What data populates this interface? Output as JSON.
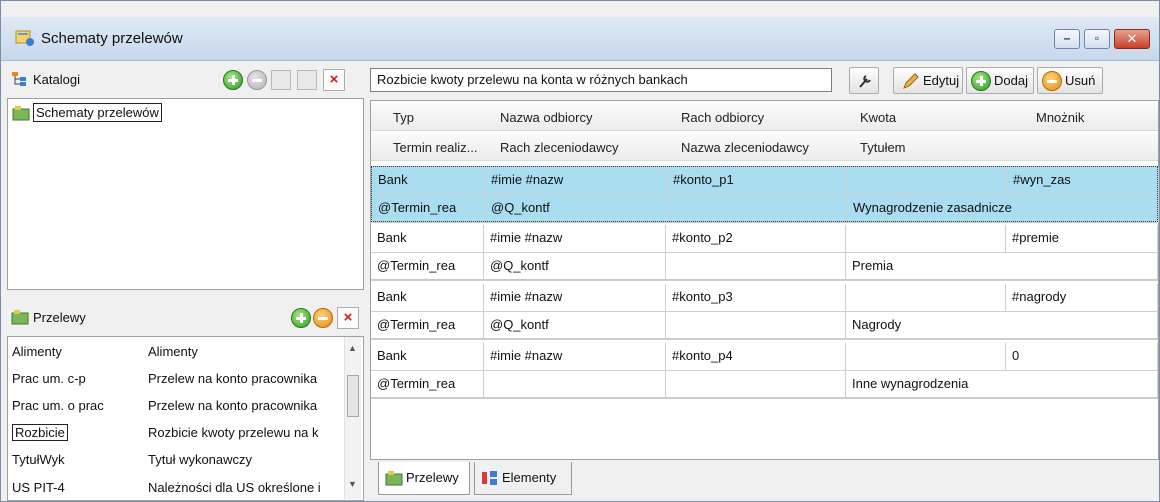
{
  "window": {
    "title": "Schematy przelewów"
  },
  "katalogi": {
    "label": "Katalogi",
    "tree_item": "Schematy przelewów"
  },
  "przelewy": {
    "label": "Przelewy",
    "items": [
      {
        "code": "Alimenty",
        "desc": "Alimenty"
      },
      {
        "code": "Prac um. c-p",
        "desc": "Przelew na konto pracownika"
      },
      {
        "code": "Prac um. o prac",
        "desc": "Przelew na konto pracownika"
      },
      {
        "code": "Rozbicie",
        "desc": "Rozbicie kwoty przelewu na k"
      },
      {
        "code": "TytułWyk",
        "desc": "Tytuł wykonawczy"
      },
      {
        "code": "US PIT-4",
        "desc": "Należności dla US określone i"
      }
    ]
  },
  "toolbar": {
    "search_value": "Rozbicie kwoty przelewu na konta w różnych bankach",
    "edit_label": "Edytuj",
    "add_label": "Dodaj",
    "delete_label": "Usuń"
  },
  "grid": {
    "header1": [
      "Typ",
      "Nazwa odbiorcy",
      "Rach odbiorcy",
      "Kwota",
      "Mnożnik"
    ],
    "header2": [
      "Termin realiz...",
      "Rach zleceniodawcy",
      "Nazwa zleceniodawcy",
      "Tytułem"
    ],
    "records": [
      {
        "r1": [
          "Bank",
          "#imie #nazw",
          "#konto_p1",
          "",
          "#wyn_zas"
        ],
        "r2": [
          "@Termin_rea",
          "@Q_kontf",
          "",
          "Wynagrodzenie zasadnicze"
        ]
      },
      {
        "r1": [
          "Bank",
          "#imie #nazw",
          "#konto_p2",
          "",
          "#premie"
        ],
        "r2": [
          "@Termin_rea",
          "@Q_kontf",
          "",
          "Premia"
        ]
      },
      {
        "r1": [
          "Bank",
          "#imie #nazw",
          "#konto_p3",
          "",
          "#nagrody"
        ],
        "r2": [
          "@Termin_rea",
          "@Q_kontf",
          "",
          "Nagrody"
        ]
      },
      {
        "r1": [
          "Bank",
          "#imie #nazw",
          "#konto_p4",
          "",
          "0"
        ],
        "r2": [
          "@Termin_rea",
          "",
          "",
          "Inne wynagrodzenia"
        ]
      }
    ]
  },
  "tabs": [
    {
      "label": "Przelewy"
    },
    {
      "label": "Elementy"
    }
  ],
  "colors": {
    "selection": "#a9ddef",
    "titlebar": "#c7d8ec"
  }
}
